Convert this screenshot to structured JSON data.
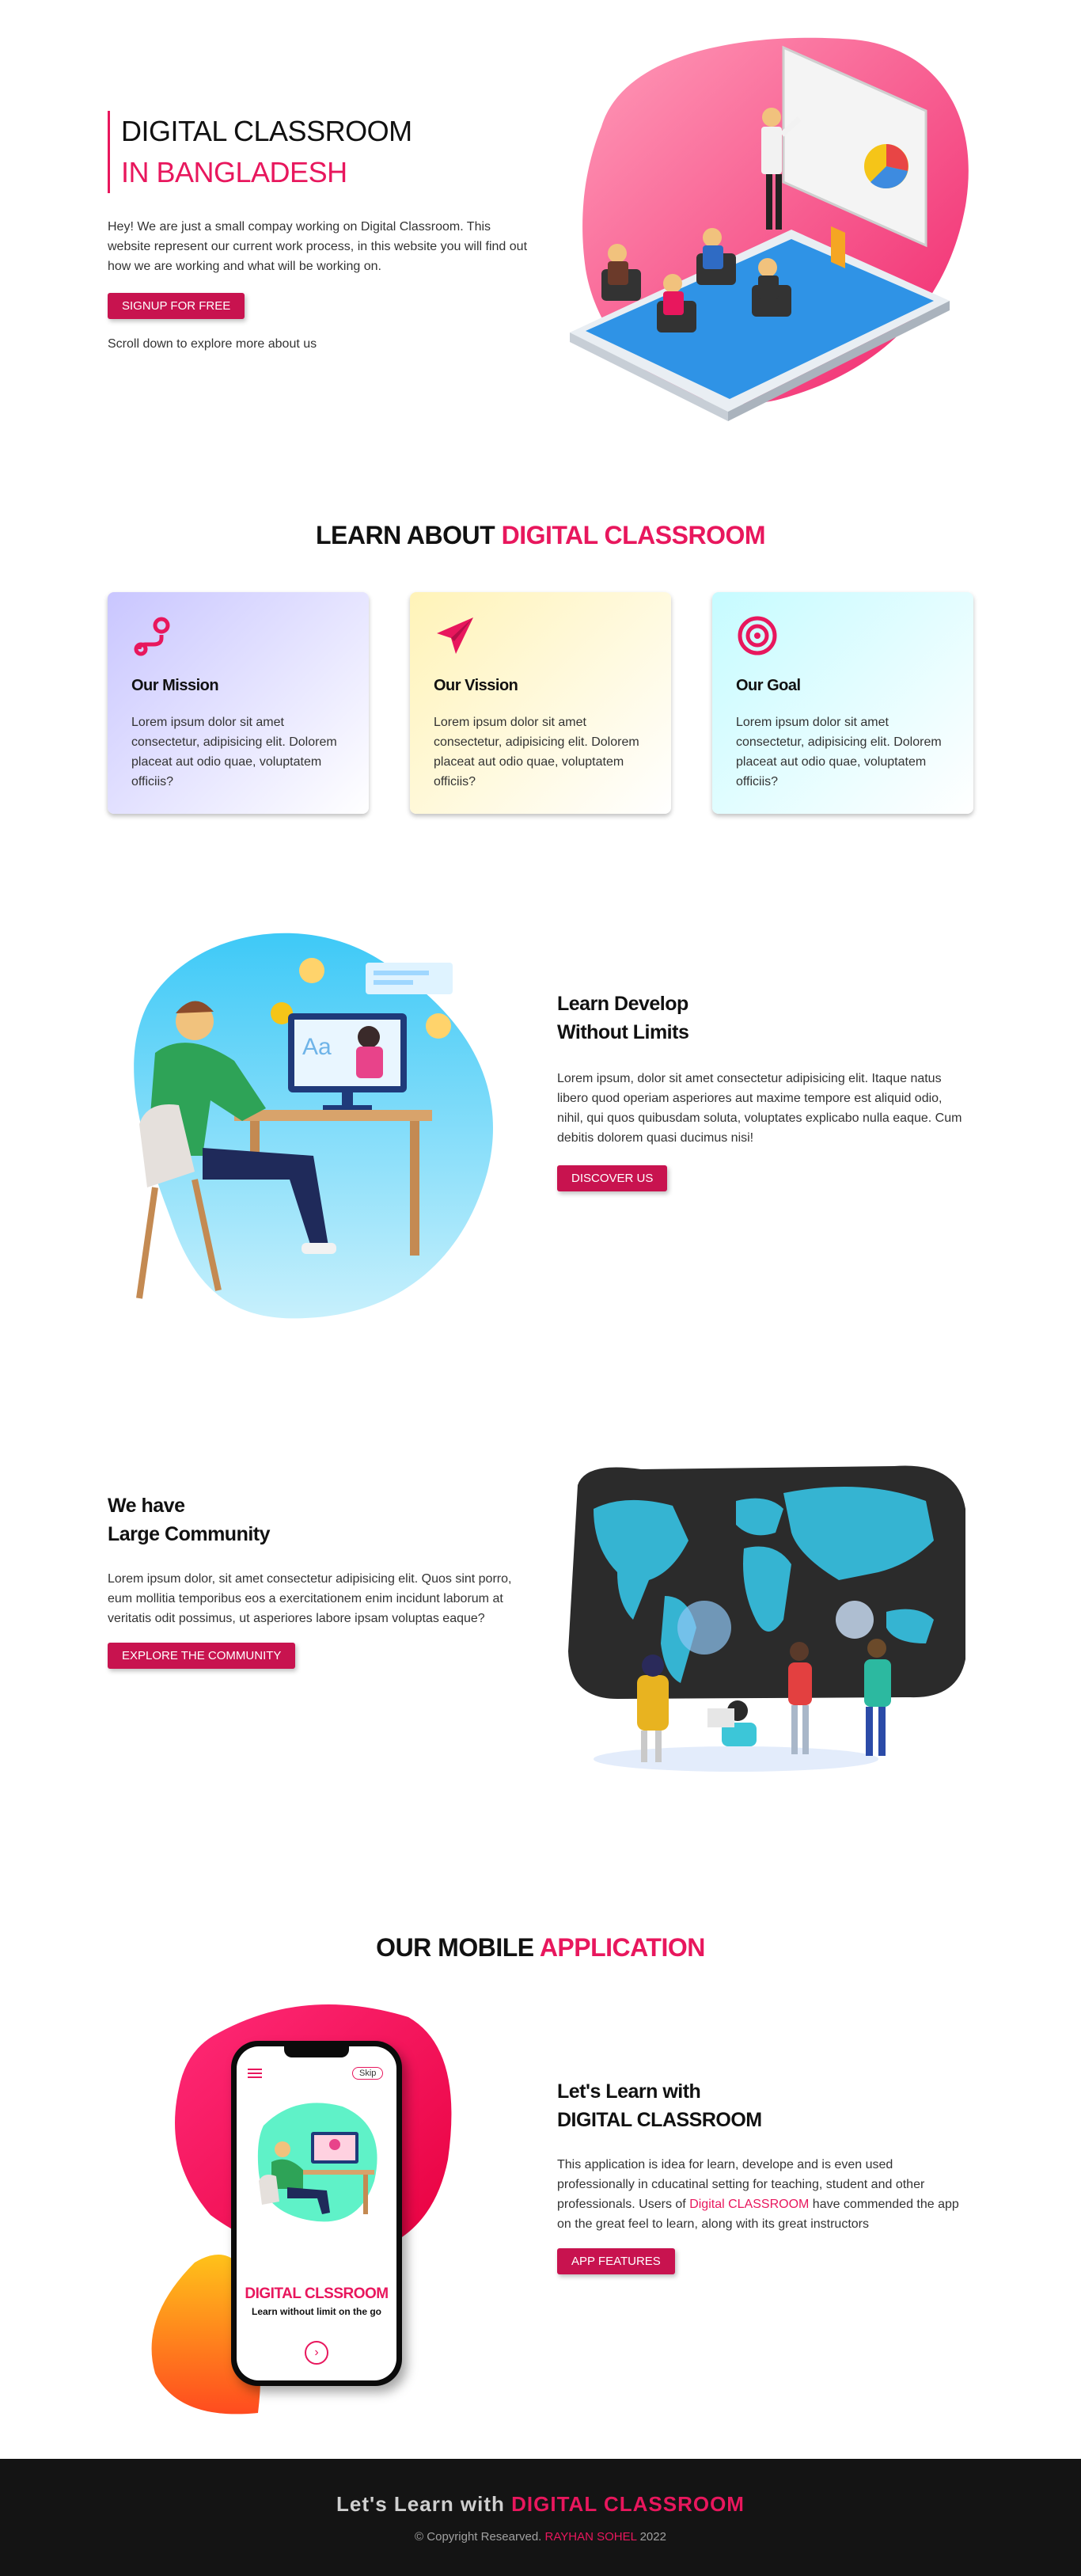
{
  "hero": {
    "title_line1": "DIGITAL CLASSROOM",
    "title_line2": "IN BANGLADESH",
    "text": "Hey! We are just a small compay working on Digital Classroom. This website represent our current work process, in this website you will find out how we are working and what will be working on.",
    "cta": "SIGNUP FOR FREE",
    "scroll_hint": "Scroll down to explore more about us"
  },
  "learn": {
    "title_a": "LEARN ABOUT",
    "title_b": "DIGITAL CLASSROOM",
    "cards": [
      {
        "title": "Our Mission",
        "icon": "route-pin-icon",
        "text": "Lorem ipsum dolor sit amet consectetur, adipisicing elit. Dolorem placeat aut odio quae, voluptatem officiis?"
      },
      {
        "title": "Our Vission",
        "icon": "paper-plane-icon",
        "text": "Lorem ipsum dolor sit amet consectetur, adipisicing elit. Dolorem placeat aut odio quae, voluptatem officiis?"
      },
      {
        "title": "Our Goal",
        "icon": "target-icon",
        "text": "Lorem ipsum dolor sit amet consectetur, adipisicing elit. Dolorem placeat aut odio quae, voluptatem officiis?"
      }
    ]
  },
  "develop": {
    "title_line1": "Learn Develop",
    "title_line2": "Without Limits",
    "text": "Lorem ipsum, dolor sit amet consectetur adipisicing elit. Itaque natus libero quod operiam asperiores aut maxime tempore est aliquid odio, nihil, qui quos quibusdam soluta, voluptates explicabo nulla eaque. Cum debitis dolorem quasi ducimus nisi!",
    "cta": "DISCOVER US",
    "monitor_text": "Aa"
  },
  "community": {
    "title_line1": "We have",
    "title_line2": "Large Community",
    "text": "Lorem ipsum dolor, sit amet consectetur adipisicing elit. Quos sint porro, eum mollitia temporibus eos a exercitationem enim incidunt laborum at veritatis odit possimus, ut asperiores labore ipsam voluptas eaque?",
    "cta": "EXPLORE THE COMMUNITY"
  },
  "mobile": {
    "title_a": "OUR MOBILE",
    "title_b": "APPLICATION",
    "heading_line1": "Let's Learn with",
    "heading_line2": "DIGITAL CLASSROOM",
    "text_before": "This application is idea for learn, develope and is even used professionally in cducatinal setting for teaching, student and other professionals. Users of ",
    "text_highlight": "Digital CLASSROOM",
    "text_after": " have commended the app on the great feel to learn, along with its great instructors",
    "cta": "APP FEATURES",
    "phone": {
      "skip": "Skip",
      "brand": "DIGITAL CLSSROOM",
      "tagline": "Learn without limit on the go"
    }
  },
  "footer": {
    "title_a": "Let's Learn with",
    "title_b": "DIGITAL CLASSROOM",
    "copy_a": "© Copyright Researved.",
    "copy_name": "RAYHAN SOHEL",
    "copy_year": "2022"
  },
  "colors": {
    "accent": "#e8175d",
    "button": "#c8134f",
    "footer_bg": "#141414"
  }
}
